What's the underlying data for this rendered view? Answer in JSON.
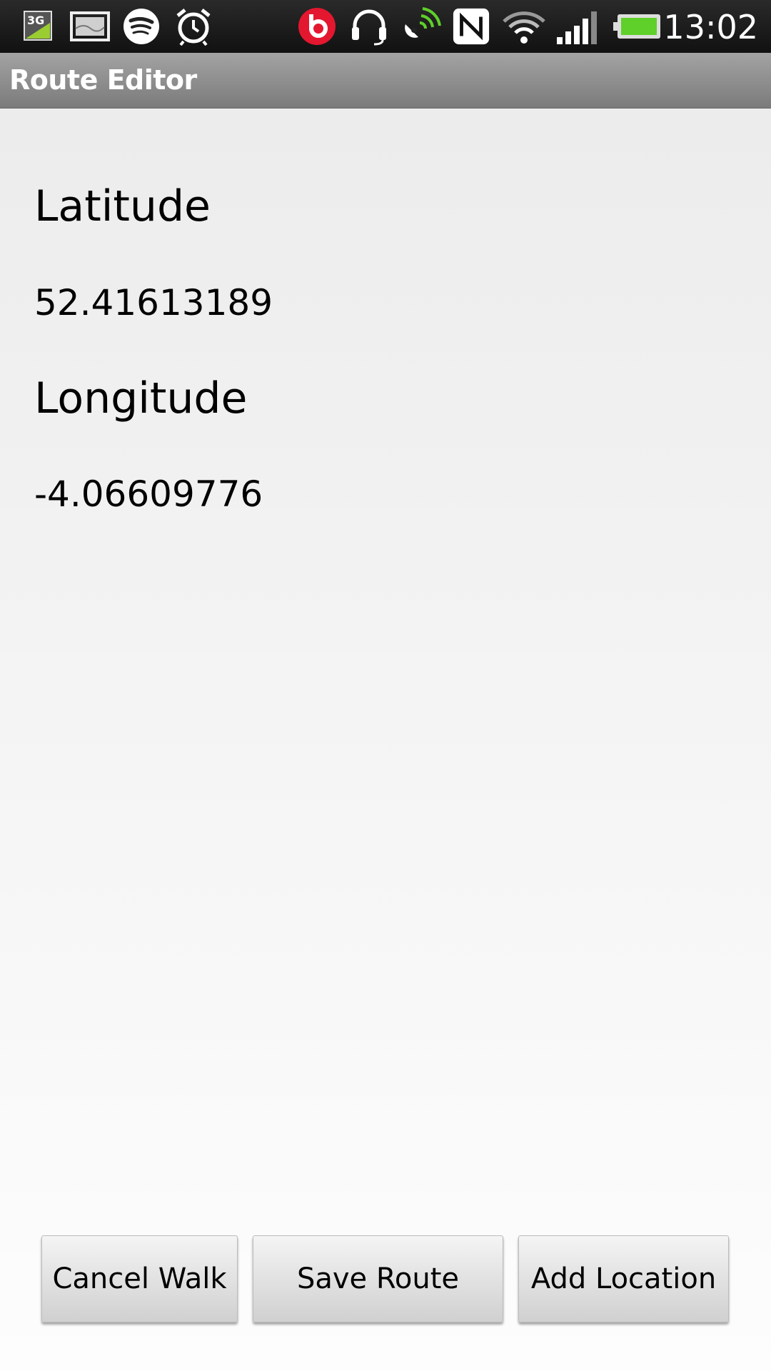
{
  "status_bar": {
    "icons": [
      "3g-icon",
      "image-notification-icon",
      "spotify-icon",
      "alarm-clock-icon",
      "beats-audio-icon",
      "headset-icon",
      "satellite-icon",
      "nfc-icon",
      "wifi-icon",
      "signal-bars-icon",
      "battery-icon"
    ],
    "time": "13:02",
    "colors": {
      "beats": "#e3172f",
      "green": "#5fcf2a"
    }
  },
  "app": {
    "title": "Route Editor"
  },
  "fields": {
    "latitude_label": "Latitude",
    "latitude_value": "52.41613189",
    "longitude_label": "Longitude",
    "longitude_value": "-4.06609776"
  },
  "buttons": {
    "cancel_walk": "Cancel Walk",
    "save_route": "Save Route",
    "add_location": "Add Location"
  }
}
